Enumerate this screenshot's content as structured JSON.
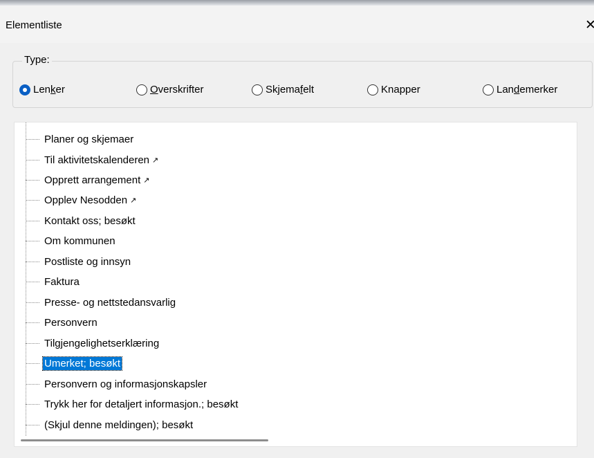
{
  "window": {
    "title": "Elementliste",
    "close_glyph": "✕"
  },
  "type_group": {
    "legend": "Type:",
    "options": [
      {
        "pre": "Len",
        "u": "k",
        "post": "er",
        "checked": true
      },
      {
        "pre": "",
        "u": "O",
        "post": "verskrifter",
        "checked": false
      },
      {
        "pre": "Skjema",
        "u": "f",
        "post": "elt",
        "checked": false
      },
      {
        "pre": "Knapper",
        "u": "",
        "post": "",
        "checked": false
      },
      {
        "pre": "Lan",
        "u": "d",
        "post": "emerker",
        "checked": false
      }
    ]
  },
  "list": {
    "items": [
      {
        "text": "Planer og skjemaer",
        "external": false
      },
      {
        "text": "Til aktivitetskalenderen",
        "external": true
      },
      {
        "text": "Opprett arrangement",
        "external": true
      },
      {
        "text": "Opplev Nesodden",
        "external": true
      },
      {
        "text": "Kontakt oss; besøkt",
        "external": false
      },
      {
        "text": "Om kommunen",
        "external": false
      },
      {
        "text": "Postliste og innsyn",
        "external": false
      },
      {
        "text": "Faktura",
        "external": false
      },
      {
        "text": "Presse- og nettstedansvarlig",
        "external": false
      },
      {
        "text": "Personvern",
        "external": false
      },
      {
        "text": "Tilgjengelighetserklæring",
        "external": false
      },
      {
        "text": "Umerket; besøkt",
        "external": false,
        "selected": true
      },
      {
        "text": "Personvern og informasjonskapsler",
        "external": false
      },
      {
        "text": "Trykk her for detaljert informasjon.; besøkt",
        "external": false
      },
      {
        "text": "(Skjul denne meldingen); besøkt",
        "external": false
      }
    ],
    "external_glyph": "↗"
  },
  "colors": {
    "selection": "#0078d7",
    "radio_checked": "#0a5fc4"
  }
}
